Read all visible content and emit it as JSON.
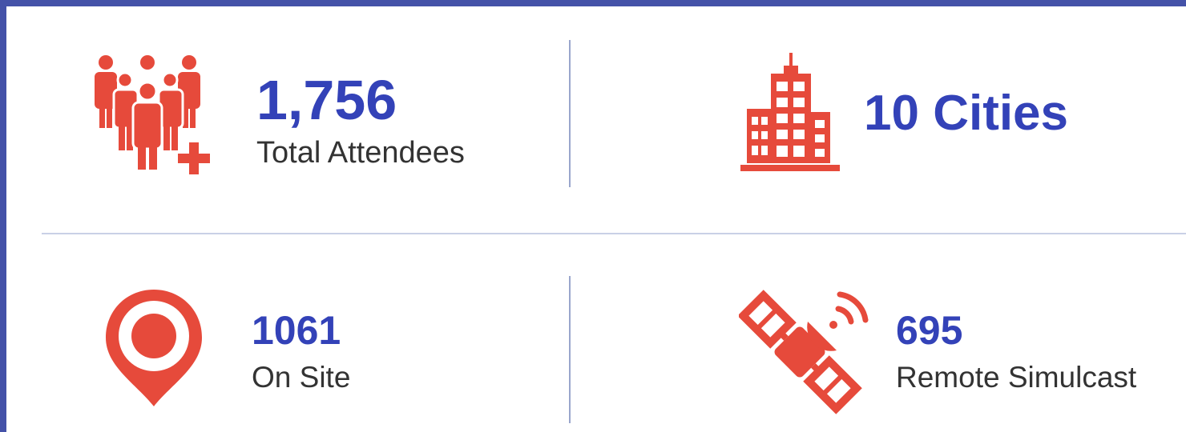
{
  "colors": {
    "accent": "#e64a3b",
    "value_text": "#3342b8",
    "label_text": "#333333",
    "border": "#4452a8",
    "divider": "#c9d0e6"
  },
  "stats": {
    "attendees": {
      "value": "1,756",
      "label": "Total Attendees",
      "icon": "people-plus-icon"
    },
    "cities": {
      "value": "10 Cities",
      "icon": "city-buildings-icon"
    },
    "onsite": {
      "value": "1061",
      "label": "On Site",
      "icon": "location-pin-icon"
    },
    "remote": {
      "value": "695",
      "label": "Remote Simulcast",
      "icon": "satellite-icon"
    }
  }
}
